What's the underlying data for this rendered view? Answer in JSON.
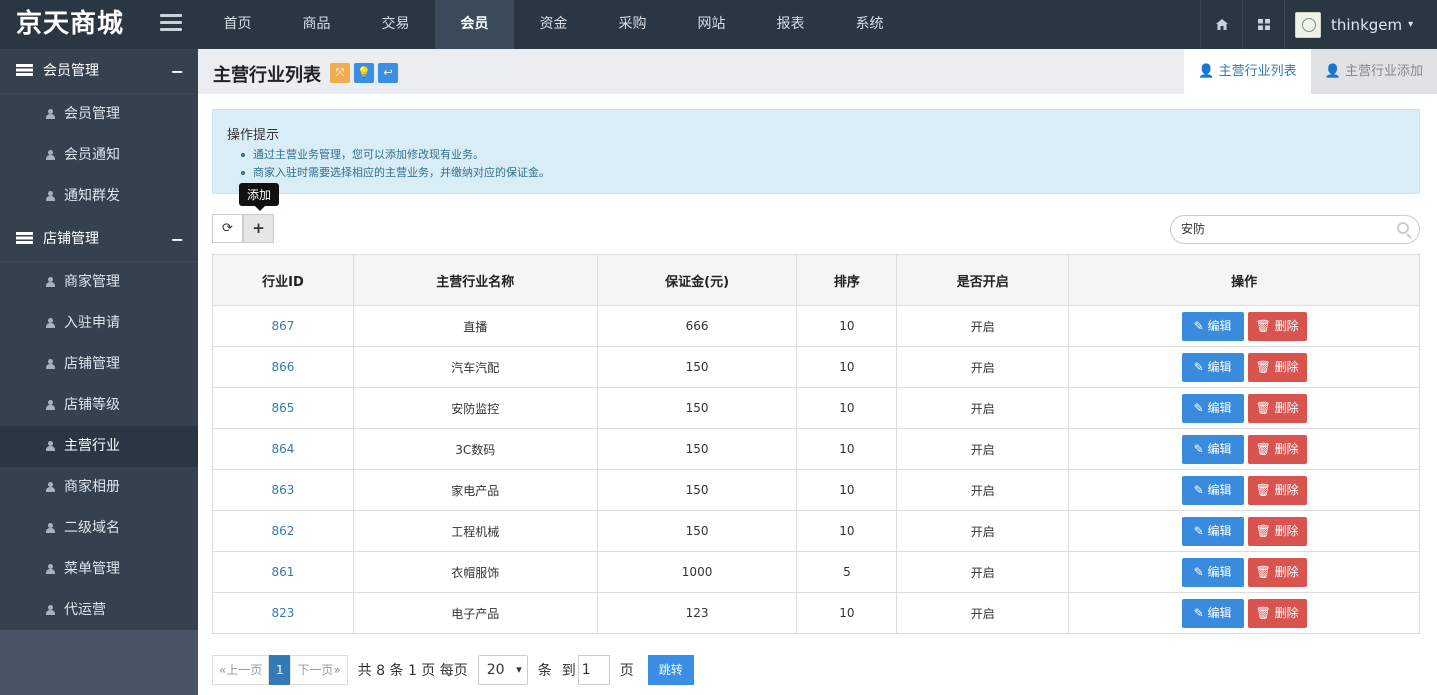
{
  "app": {
    "logo": "京天商城"
  },
  "topnav": [
    "首页",
    "商品",
    "交易",
    "会员",
    "资金",
    "采购",
    "网站",
    "报表",
    "系统"
  ],
  "user": {
    "name": "thinkgem"
  },
  "sidebar": {
    "groups": [
      {
        "title": "会员管理",
        "toggle": "−",
        "items": [
          "会员管理",
          "会员通知",
          "通知群发"
        ]
      },
      {
        "title": "店铺管理",
        "toggle": "−",
        "items": [
          "商家管理",
          "入驻申请",
          "店铺管理",
          "店铺等级",
          "主营行业",
          "商家相册",
          "二级域名",
          "菜单管理",
          "代运营"
        ]
      }
    ],
    "active": "主营行业"
  },
  "page": {
    "title": "主营行业列表",
    "tabs": {
      "list": "主营行业列表",
      "add": "主营行业添加"
    }
  },
  "tips": {
    "title": "操作提示",
    "items": [
      "通过主营业务管理，您可以添加修改现有业务。",
      "商家入驻时需要选择相应的主营业务，并缴纳对应的保证金。"
    ]
  },
  "toolbar": {
    "tooltip": "添加",
    "refresh": "⟳",
    "add": "+"
  },
  "search": {
    "value": "安防"
  },
  "table": {
    "headers": [
      "行业ID",
      "主营行业名称",
      "保证金(元)",
      "排序",
      "是否开启",
      "操作"
    ],
    "edit_label": "编辑",
    "delete_label": "删除",
    "rows": [
      {
        "id": "867",
        "name": "直播",
        "deposit": "666",
        "sort": "10",
        "open": "开启"
      },
      {
        "id": "866",
        "name": "汽车汽配",
        "deposit": "150",
        "sort": "10",
        "open": "开启"
      },
      {
        "id": "865",
        "name": "安防监控",
        "deposit": "150",
        "sort": "10",
        "open": "开启"
      },
      {
        "id": "864",
        "name": "3C数码",
        "deposit": "150",
        "sort": "10",
        "open": "开启"
      },
      {
        "id": "863",
        "name": "家电产品",
        "deposit": "150",
        "sort": "10",
        "open": "开启"
      },
      {
        "id": "862",
        "name": "工程机械",
        "deposit": "150",
        "sort": "10",
        "open": "开启"
      },
      {
        "id": "861",
        "name": "衣帽服饰",
        "deposit": "1000",
        "sort": "5",
        "open": "开启"
      },
      {
        "id": "823",
        "name": "电子产品",
        "deposit": "123",
        "sort": "10",
        "open": "开启"
      }
    ]
  },
  "pager": {
    "prev": "«上一页",
    "current": "1",
    "next": "下一页»",
    "summary": "共 8 条 1 页 每页",
    "page_size": "20",
    "unit": "条",
    "goto": "到",
    "goto_value": "1",
    "page_word": "页",
    "jump": "跳转"
  }
}
